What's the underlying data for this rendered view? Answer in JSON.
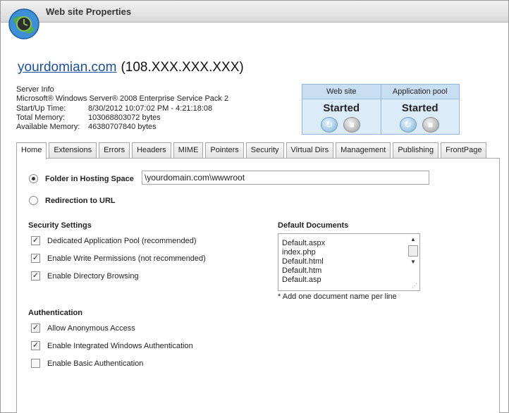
{
  "window": {
    "title": "Web site Properties"
  },
  "header": {
    "domain": "yourdomian.com",
    "ip": "(108.XXX.XXX.XXX)"
  },
  "server_info": {
    "heading": "Server Info",
    "os": "Microsoft® Windows Server® 2008 Enterprise Service Pack 2",
    "rows": [
      {
        "label": "Start/Up Time:",
        "value": "8/30/2012 10:07:02 PM - 4:21:18:08"
      },
      {
        "label": "Total Memory:",
        "value": "103068803072 bytes"
      },
      {
        "label": "Available Memory:",
        "value": "46380707840 bytes"
      }
    ]
  },
  "status": {
    "website_label": "Web site",
    "website_state": "Started",
    "apppool_label": "Application pool",
    "apppool_state": "Started"
  },
  "tabs": [
    "Home",
    "Extensions",
    "Errors",
    "Headers",
    "MIME",
    "Pointers",
    "Security",
    "Virtual Dirs",
    "Management",
    "Publishing",
    "FrontPage"
  ],
  "home": {
    "folder_label": "Folder in Hosting Space",
    "folder_value": "\\yourdomain.com\\wwwroot",
    "redirect_label": "Redirection to URL",
    "security_heading": "Security Settings",
    "security": [
      {
        "label": "Dedicated Application Pool (recommended)",
        "checked": true
      },
      {
        "label": "Enable Write Permissions (not recommended)",
        "checked": true
      },
      {
        "label": "Enable Directory Browsing",
        "checked": true
      }
    ],
    "auth_heading": "Authentication",
    "auth": [
      {
        "label": "Allow Anonymous Access",
        "checked": true
      },
      {
        "label": "Enable Integrated Windows Authentication",
        "checked": true
      },
      {
        "label": "Enable Basic Authentication",
        "checked": false
      }
    ],
    "default_docs_heading": "Default Documents",
    "default_docs": [
      "Default.aspx",
      "index.php",
      "Default.html",
      "Default.htm",
      "Default.asp"
    ],
    "default_docs_note": "* Add one document name per line"
  },
  "colors": {
    "accent_link": "#1a4fa0",
    "status_panel": "#dcebf8"
  },
  "icons": {
    "app": "globe-clock-icon",
    "refresh": "refresh-icon",
    "stop": "stop-icon"
  }
}
